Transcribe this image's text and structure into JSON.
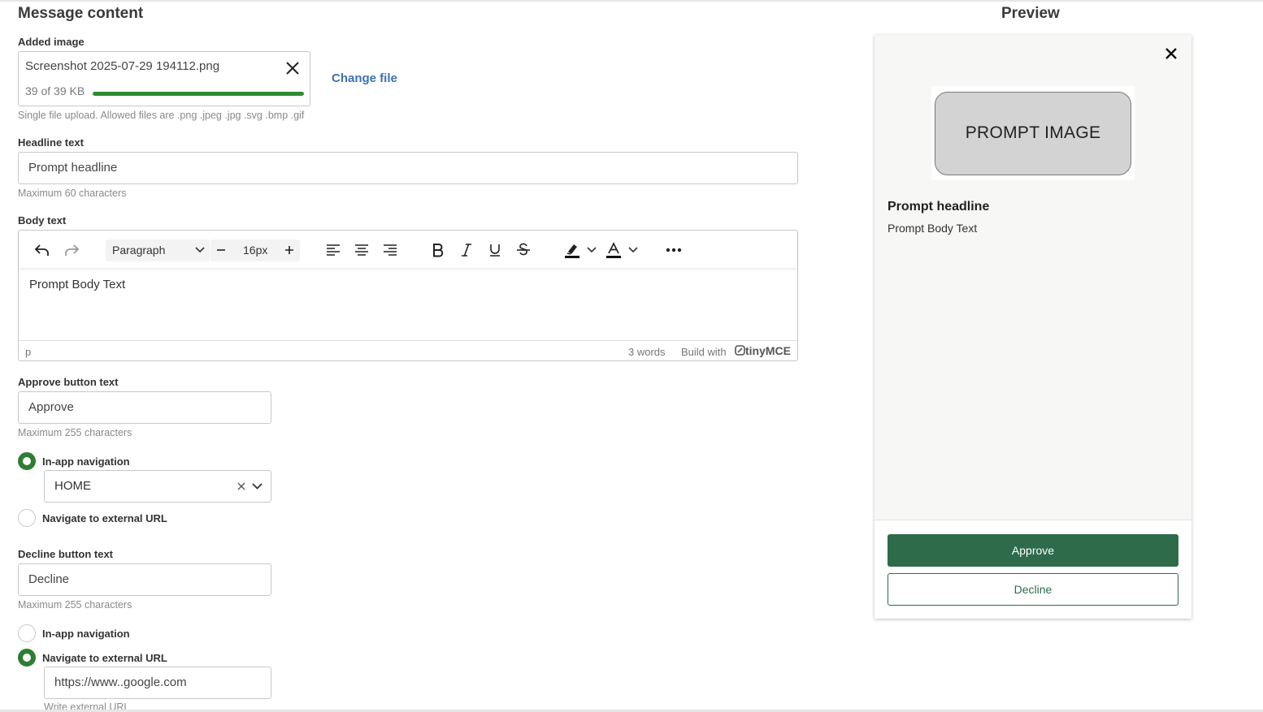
{
  "form": {
    "title": "Message content",
    "image": {
      "label": "Added image",
      "file_name": "Screenshot 2025-07-29 194112.png",
      "file_size": "39 of 39 KB",
      "progress_percent": 100,
      "change_file": "Change file",
      "hint": "Single file upload. Allowed files are .png .jpeg .jpg .svg .bmp .gif"
    },
    "headline": {
      "label": "Headline text",
      "value": "Prompt headline",
      "hint": "Maximum 60 characters"
    },
    "body": {
      "label": "Body text",
      "format": "Paragraph",
      "font_size": "16px",
      "content": "Prompt Body Text",
      "status_element": "p",
      "word_count": "3 words",
      "build_with": "Build with",
      "brand": "tinyMCE"
    },
    "approve": {
      "label": "Approve button text",
      "value": "Approve",
      "hint": "Maximum 255 characters",
      "option_inapp": "In-app navigation",
      "option_external": "Navigate to external URL",
      "selected": "in-app",
      "nav_value": "HOME"
    },
    "decline": {
      "label": "Decline button text",
      "value": "Decline",
      "hint": "Maximum 255 characters",
      "option_inapp": "In-app navigation",
      "option_external": "Navigate to external URL",
      "selected": "external",
      "url_value": "https://www..google.com",
      "url_hint": "Write external URL"
    }
  },
  "preview": {
    "title": "Preview",
    "image_text": "PROMPT IMAGE",
    "headline": "Prompt headline",
    "body": "Prompt Body Text",
    "approve_label": "Approve",
    "decline_label": "Decline"
  },
  "colors": {
    "accent_green": "#2e7d32",
    "progress_green": "#2e8b2e",
    "button_green": "#2e6b4a",
    "link_blue": "#3d6fb5"
  }
}
